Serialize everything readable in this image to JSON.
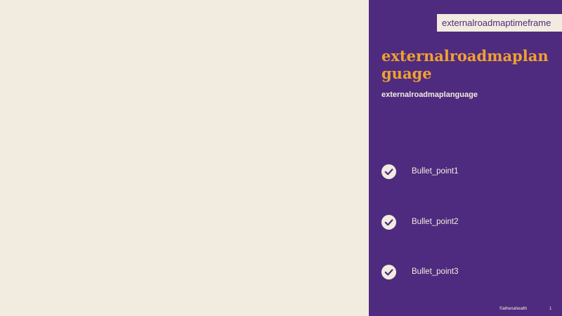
{
  "slide": {
    "timeframe": "externalroadmaptimeframe",
    "title": "externalroadmaplanguage",
    "subtitle": "externalroadmaplanguage",
    "bullets": [
      {
        "label": "Bullet_point1",
        "icon": "check-circle-icon"
      },
      {
        "label": "Bullet_point2",
        "icon": "check-circle-icon"
      },
      {
        "label": "Bullet_point3",
        "icon": "check-circle-icon"
      }
    ],
    "footer": {
      "brand": "©athenahealth",
      "page_number": "1"
    }
  },
  "colors": {
    "background": "#f2ebe0",
    "panel": "#4e2b7e",
    "title_accent": "#f0a030",
    "light_text": "#f2ebe0"
  }
}
